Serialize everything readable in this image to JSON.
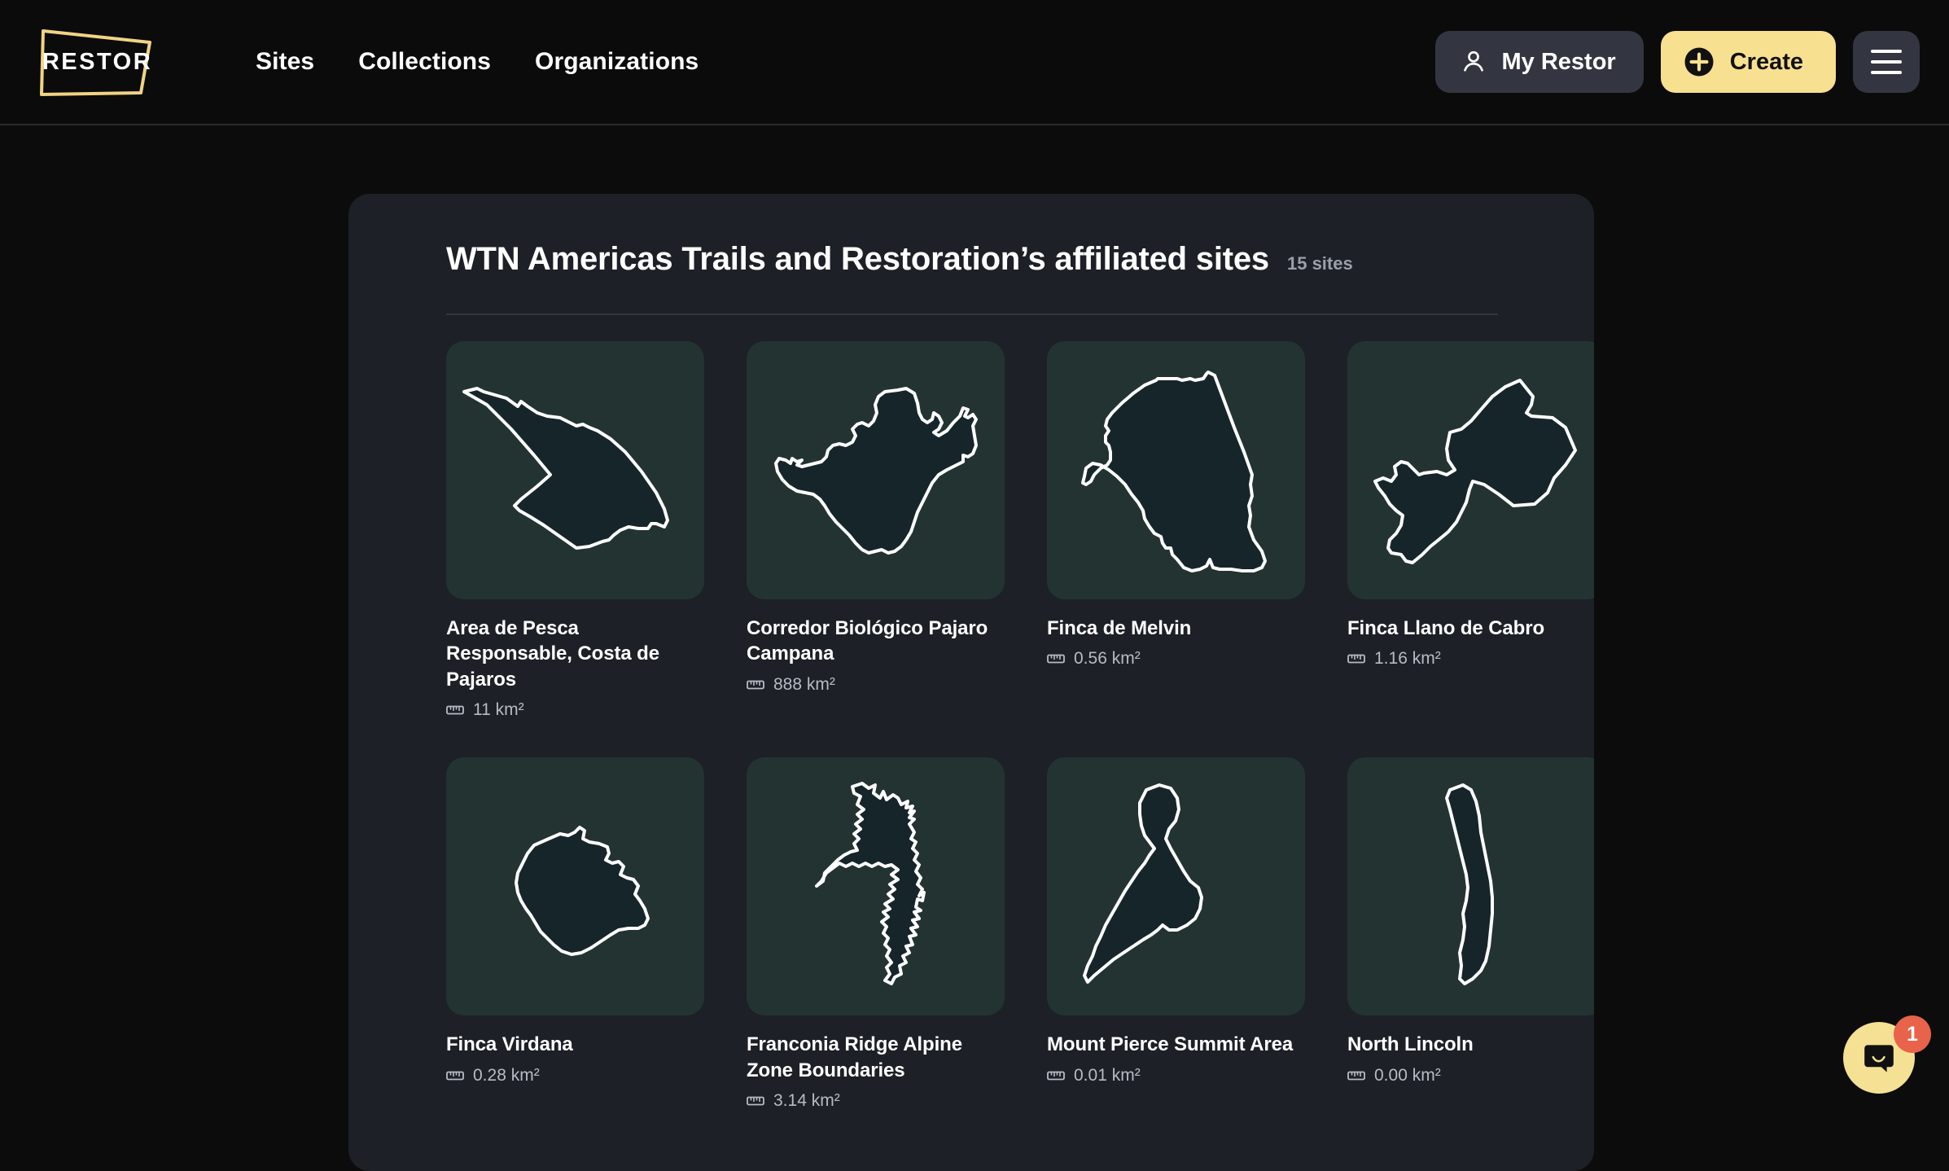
{
  "header": {
    "logo_text": "RESTOR",
    "logo_icon": "restor-trapezoid-logo",
    "nav": [
      {
        "label": "Sites"
      },
      {
        "label": "Collections"
      },
      {
        "label": "Organizations"
      }
    ],
    "my_restor_label": "My Restor",
    "my_restor_icon": "person-icon",
    "create_label": "Create",
    "create_icon": "plus-circle-icon",
    "menu_icon": "hamburger-menu-icon"
  },
  "panel": {
    "title": "WTN Americas Trails and Restoration’s affiliated sites",
    "count_label": "15 sites",
    "area_icon": "ruler-icon",
    "sites": [
      {
        "name": "Area de Pesca Responsable, Costa de Pajaros",
        "area": "11 km²"
      },
      {
        "name": "Corredor Biológico Pajaro Campana",
        "area": "888 km²"
      },
      {
        "name": "Finca de Melvin",
        "area": "0.56 km²"
      },
      {
        "name": "Finca Llano de Cabro",
        "area": "1.16 km²"
      },
      {
        "name": "Finca Virdana",
        "area": "0.28 km²"
      },
      {
        "name": "Franconia Ridge Alpine Zone Boundaries",
        "area": "3.14 km²"
      },
      {
        "name": "Mount Pierce Summit Area",
        "area": "0.01 km²"
      },
      {
        "name": "North Lincoln",
        "area": "0.00 km²"
      }
    ]
  },
  "chat": {
    "badge_count": "1",
    "icon": "chat-bubble-icon"
  },
  "colors": {
    "page_background": "#0c0c0c",
    "panel_background": "#1d2026",
    "accent_yellow": "#f7e08f",
    "thumbnail_background": "#233331",
    "thumbnail_fill": "#162523",
    "thumbnail_stroke": "#ffffff",
    "badge_red": "#e8634a",
    "muted_text": "#9aa0a8"
  }
}
